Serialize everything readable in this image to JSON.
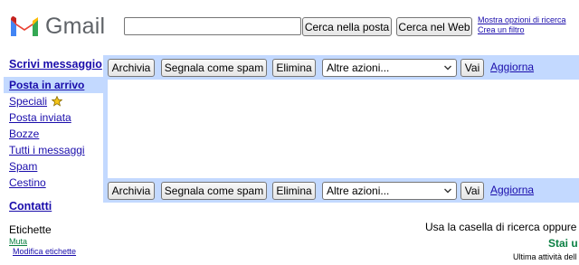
{
  "header": {
    "logo_text": "Gmail",
    "search_placeholder": "",
    "search_mail_label": "Cerca nella posta",
    "search_web_label": "Cerca nel Web",
    "advanced_search_link": "Mostra opzioni di ricerca",
    "create_filter_link": "Crea un filtro"
  },
  "sidebar": {
    "compose_label": "Scrivi messaggio",
    "items": [
      {
        "label": "Posta in arrivo",
        "active": true
      },
      {
        "label": "Speciali"
      },
      {
        "label": "Posta inviata"
      },
      {
        "label": "Bozze"
      },
      {
        "label": "Tutti i messaggi"
      },
      {
        "label": "Spam"
      },
      {
        "label": "Cestino"
      }
    ],
    "contacts_label": "Contatti",
    "labels_title": "Etichette",
    "label_muta": "Muta",
    "edit_labels": "Modifica etichette"
  },
  "toolbar": {
    "archive_label": "Archivia",
    "report_spam_label": "Segnala come spam",
    "delete_label": "Elimina",
    "more_actions_label": "Altre azioni...",
    "go_label": "Vai",
    "refresh_label": "Aggiorna"
  },
  "footer": {
    "hint_text": "Usa la casella di ricerca oppure l",
    "promo_text": "Stai u",
    "activity_text": "Ultima attività dell"
  },
  "colors": {
    "accent": "#c3d9ff",
    "link": "#1a0dab",
    "label_green": "#0b8043",
    "star": "#f5c518"
  }
}
